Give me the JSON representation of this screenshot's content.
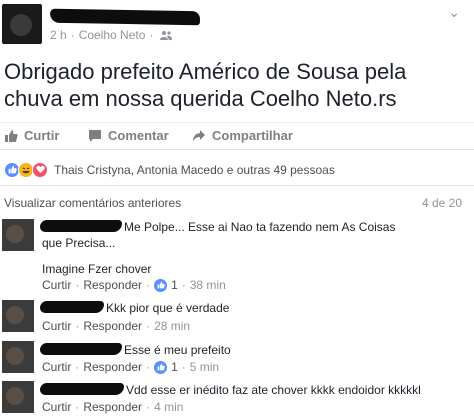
{
  "post": {
    "time": "2 h",
    "location": "Coelho Neto",
    "audience_icon": "friends-icon",
    "text": "Obrigado prefeito Américo de Sousa pela chuva em nossa querida Coelho Neto.rs"
  },
  "actions": {
    "like": "Curtir",
    "comment": "Comentar",
    "share": "Compartilhar"
  },
  "reactions": {
    "text": "Thais Cristyna, Antonia Macedo e outras 49 pessoas",
    "types": [
      "like",
      "haha",
      "love"
    ]
  },
  "comments_header": {
    "previous": "Visualizar comentários anteriores",
    "count": "4 de 20"
  },
  "comments": [
    {
      "text": "Me Polpe... Esse ai Nao ta fazendo nem As Coisas que Precisa...",
      "extra": "Imagine Fzer chover",
      "like": "Curtir",
      "reply": "Responder",
      "reactions": "1",
      "time": "38 min"
    },
    {
      "text": "Kkk pior que é verdade",
      "like": "Curtir",
      "reply": "Responder",
      "time": "28 min"
    },
    {
      "text": "Esse é meu prefeito",
      "like": "Curtir",
      "reply": "Responder",
      "reactions": "1",
      "time": "5 min"
    },
    {
      "text": "Vdd esse er inédito faz ate chover kkkk endoidor kkkkkl",
      "like": "Curtir",
      "reply": "Responder",
      "time": "4 min"
    }
  ],
  "colors": {
    "link_blue": "#5890ff",
    "text_gray": "#90949c",
    "love_red": "#f25268",
    "haha_yellow": "#f7b125"
  }
}
